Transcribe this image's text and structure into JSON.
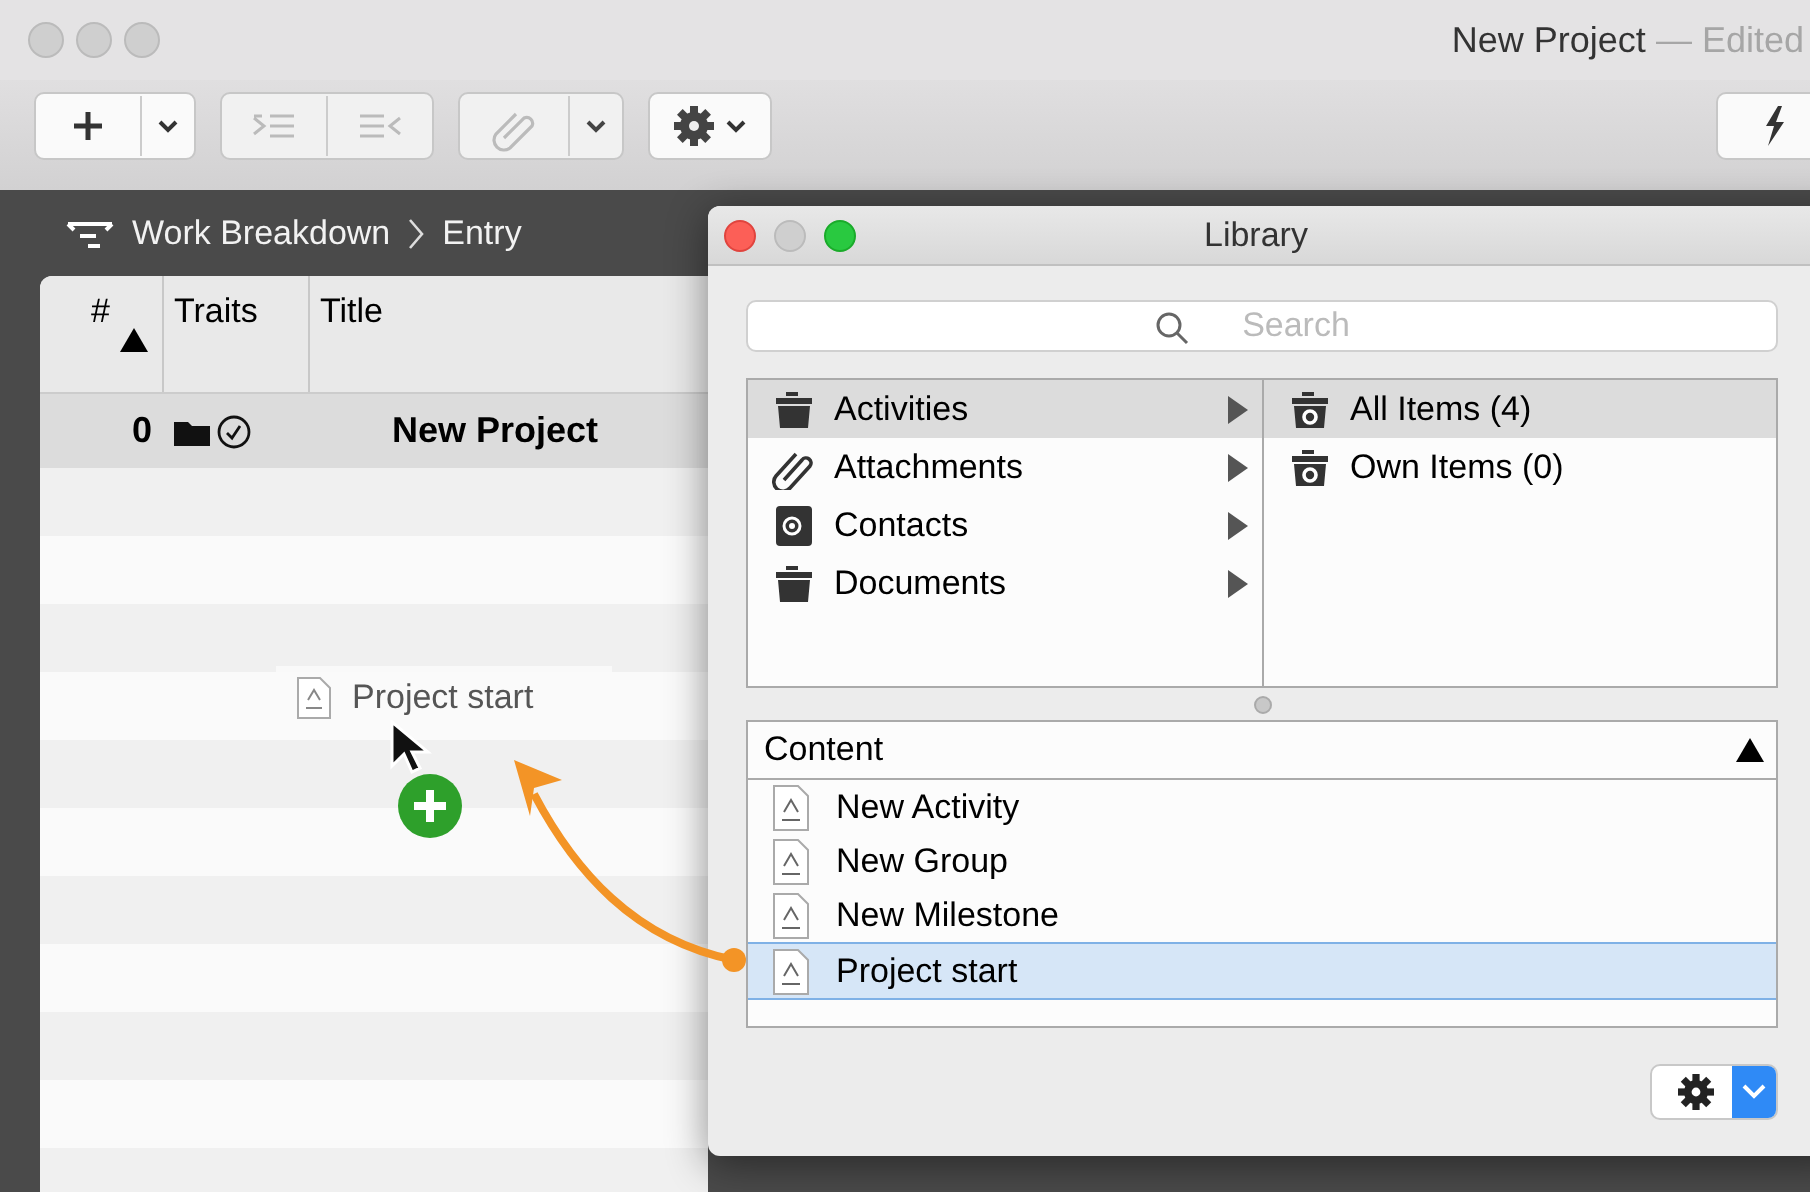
{
  "window": {
    "title": "New Project",
    "status": "— Edited"
  },
  "breadcrumb": [
    "Work Breakdown",
    "Entry"
  ],
  "table": {
    "columns": [
      {
        "label": "#",
        "sorted": true
      },
      {
        "label": "Traits",
        "sorted": false
      },
      {
        "label": "Title",
        "sorted": false
      }
    ],
    "rows": [
      {
        "number": "0",
        "title": "New Project",
        "selected": true
      }
    ]
  },
  "drag": {
    "label": "Project start"
  },
  "library": {
    "title": "Library",
    "search": {
      "placeholder": "Search"
    },
    "categories": [
      {
        "label": "Activities",
        "kind": "folder",
        "selected": true
      },
      {
        "label": "Attachments",
        "kind": "clip",
        "selected": false
      },
      {
        "label": "Contacts",
        "kind": "contacts",
        "selected": false
      },
      {
        "label": "Documents",
        "kind": "folder",
        "selected": false
      }
    ],
    "collections": [
      {
        "label": "All Items (4)",
        "selected": true
      },
      {
        "label": "Own Items (0)",
        "selected": false
      }
    ],
    "content": {
      "header": "Content",
      "sorted": true,
      "items": [
        {
          "label": "New Activity",
          "selected": false
        },
        {
          "label": "New Group",
          "selected": false
        },
        {
          "label": "New Milestone",
          "selected": false
        },
        {
          "label": "Project start",
          "selected": true
        }
      ]
    }
  }
}
